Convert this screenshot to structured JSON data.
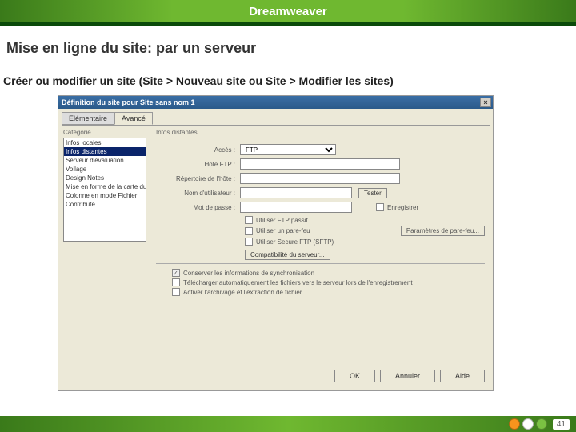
{
  "header": {
    "app": "Dreamweaver"
  },
  "slide": {
    "title": "Mise en ligne du site: par un serveur",
    "subtitle": "Créer ou modifier un site (Site > Nouveau  site ou Site > Modifier les sites)"
  },
  "dialog": {
    "title": "Définition du site pour Site sans nom 1",
    "close": "×",
    "tabs": {
      "basic": "Elémentaire",
      "advanced": "Avancé"
    },
    "category_label": "Catégorie",
    "remote_label": "Infos distantes",
    "categories": [
      "Infos locales",
      "Infos distantes",
      "Serveur d'évaluation",
      "Voilage",
      "Design Notes",
      "Mise en forme de la carte du site",
      "Colonne en mode Fichier",
      "Contribute"
    ],
    "selected_category_index": 1,
    "form": {
      "access_label": "Accès :",
      "access_value": "FTP",
      "host_label": "Hôte FTP :",
      "folder_label": "Répertoire de l'hôte :",
      "login_label": "Nom d'utilisateur :",
      "password_label": "Mot de passe :",
      "test_btn": "Tester",
      "save_chk": "Enregistrer",
      "passive_chk": "Utiliser FTP passif",
      "firewall_chk": "Utiliser un pare-feu",
      "sftp_chk": "Utiliser Secure FTP (SFTP)",
      "fw_settings_btn": "Paramètres de pare-feu...",
      "server_compat_btn": "Compatibilité du serveur...",
      "sync_chk": "Conserver les informations de synchronisation",
      "getput_chk": "Télécharger automatiquement les fichiers vers le serveur lors de l'enregistrement",
      "checkout_chk": "Activer l'archivage et l'extraction de fichier"
    },
    "buttons": {
      "ok": "OK",
      "cancel": "Annuler",
      "help": "Aide"
    }
  },
  "footer": {
    "page": "41"
  }
}
